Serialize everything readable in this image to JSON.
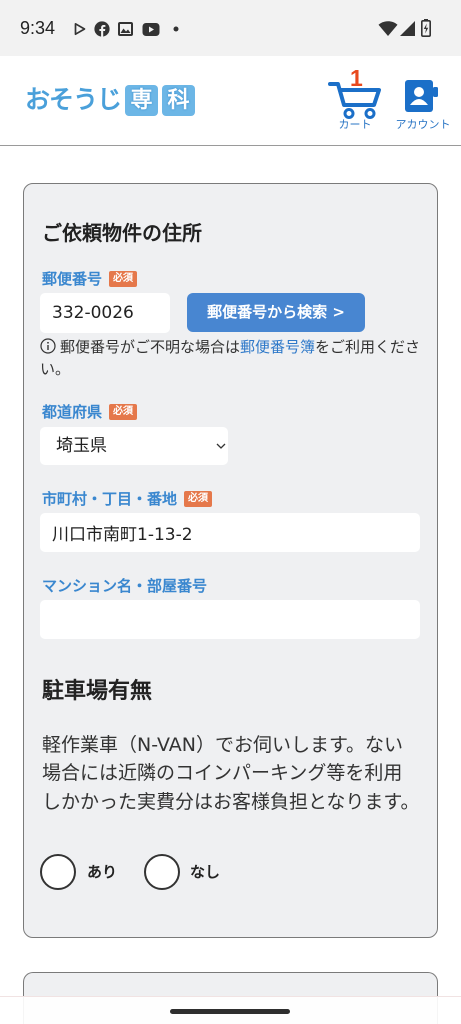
{
  "status_bar": {
    "time": "9:34",
    "notification_icons": [
      "play-store-icon",
      "facebook-icon",
      "gallery-icon",
      "youtube-icon",
      "more-notifications-dot-icon"
    ],
    "system_icons": [
      "wifi-icon",
      "cell-signal-icon",
      "battery-charging-icon"
    ]
  },
  "header": {
    "logo": {
      "text_part": "おそうじ",
      "boxed_part": [
        "専",
        "科"
      ]
    },
    "cart": {
      "icon": "cart-icon",
      "count": "1",
      "label": "カート"
    },
    "account": {
      "icon": "account-icon",
      "label": "アカウント"
    }
  },
  "address_form": {
    "title": "ご依頼物件の住所",
    "required_badge": "必須",
    "postal_code": {
      "label": "郵便番号",
      "value": "332-0026",
      "search_button": "郵便番号から検索 >",
      "help": {
        "icon": "info-icon",
        "before_link": "郵便番号がご不明な場合は",
        "link": "郵便番号簿",
        "after_link": "をご利用ください。"
      }
    },
    "prefecture": {
      "label": "都道府県",
      "selected": "埼玉県",
      "icon": "chevron-down-icon"
    },
    "city_address": {
      "label": "市町村・丁目・番地",
      "value": "川口市南町1-13-2"
    },
    "building": {
      "label": "マンション名・部屋番号",
      "value": ""
    },
    "parking": {
      "title": "駐車場有無",
      "description": "軽作業車（N-VAN）でお伺いします。ない場合には近隣のコインパーキング等を利用しかかった実費分はお客様負担となります。",
      "options": [
        {
          "label": "あり",
          "selected": false
        },
        {
          "label": "なし",
          "selected": false
        }
      ]
    }
  },
  "colors": {
    "brand_blue": "#1b6fc8",
    "logo_blue": "#4aa0da",
    "label_blue": "#3a87cf",
    "button_blue": "#4886d1",
    "link_blue": "#2f79c9",
    "required_orange": "#e5784b",
    "cart_badge_red": "#e8491d",
    "card_background": "#eff0f2"
  }
}
